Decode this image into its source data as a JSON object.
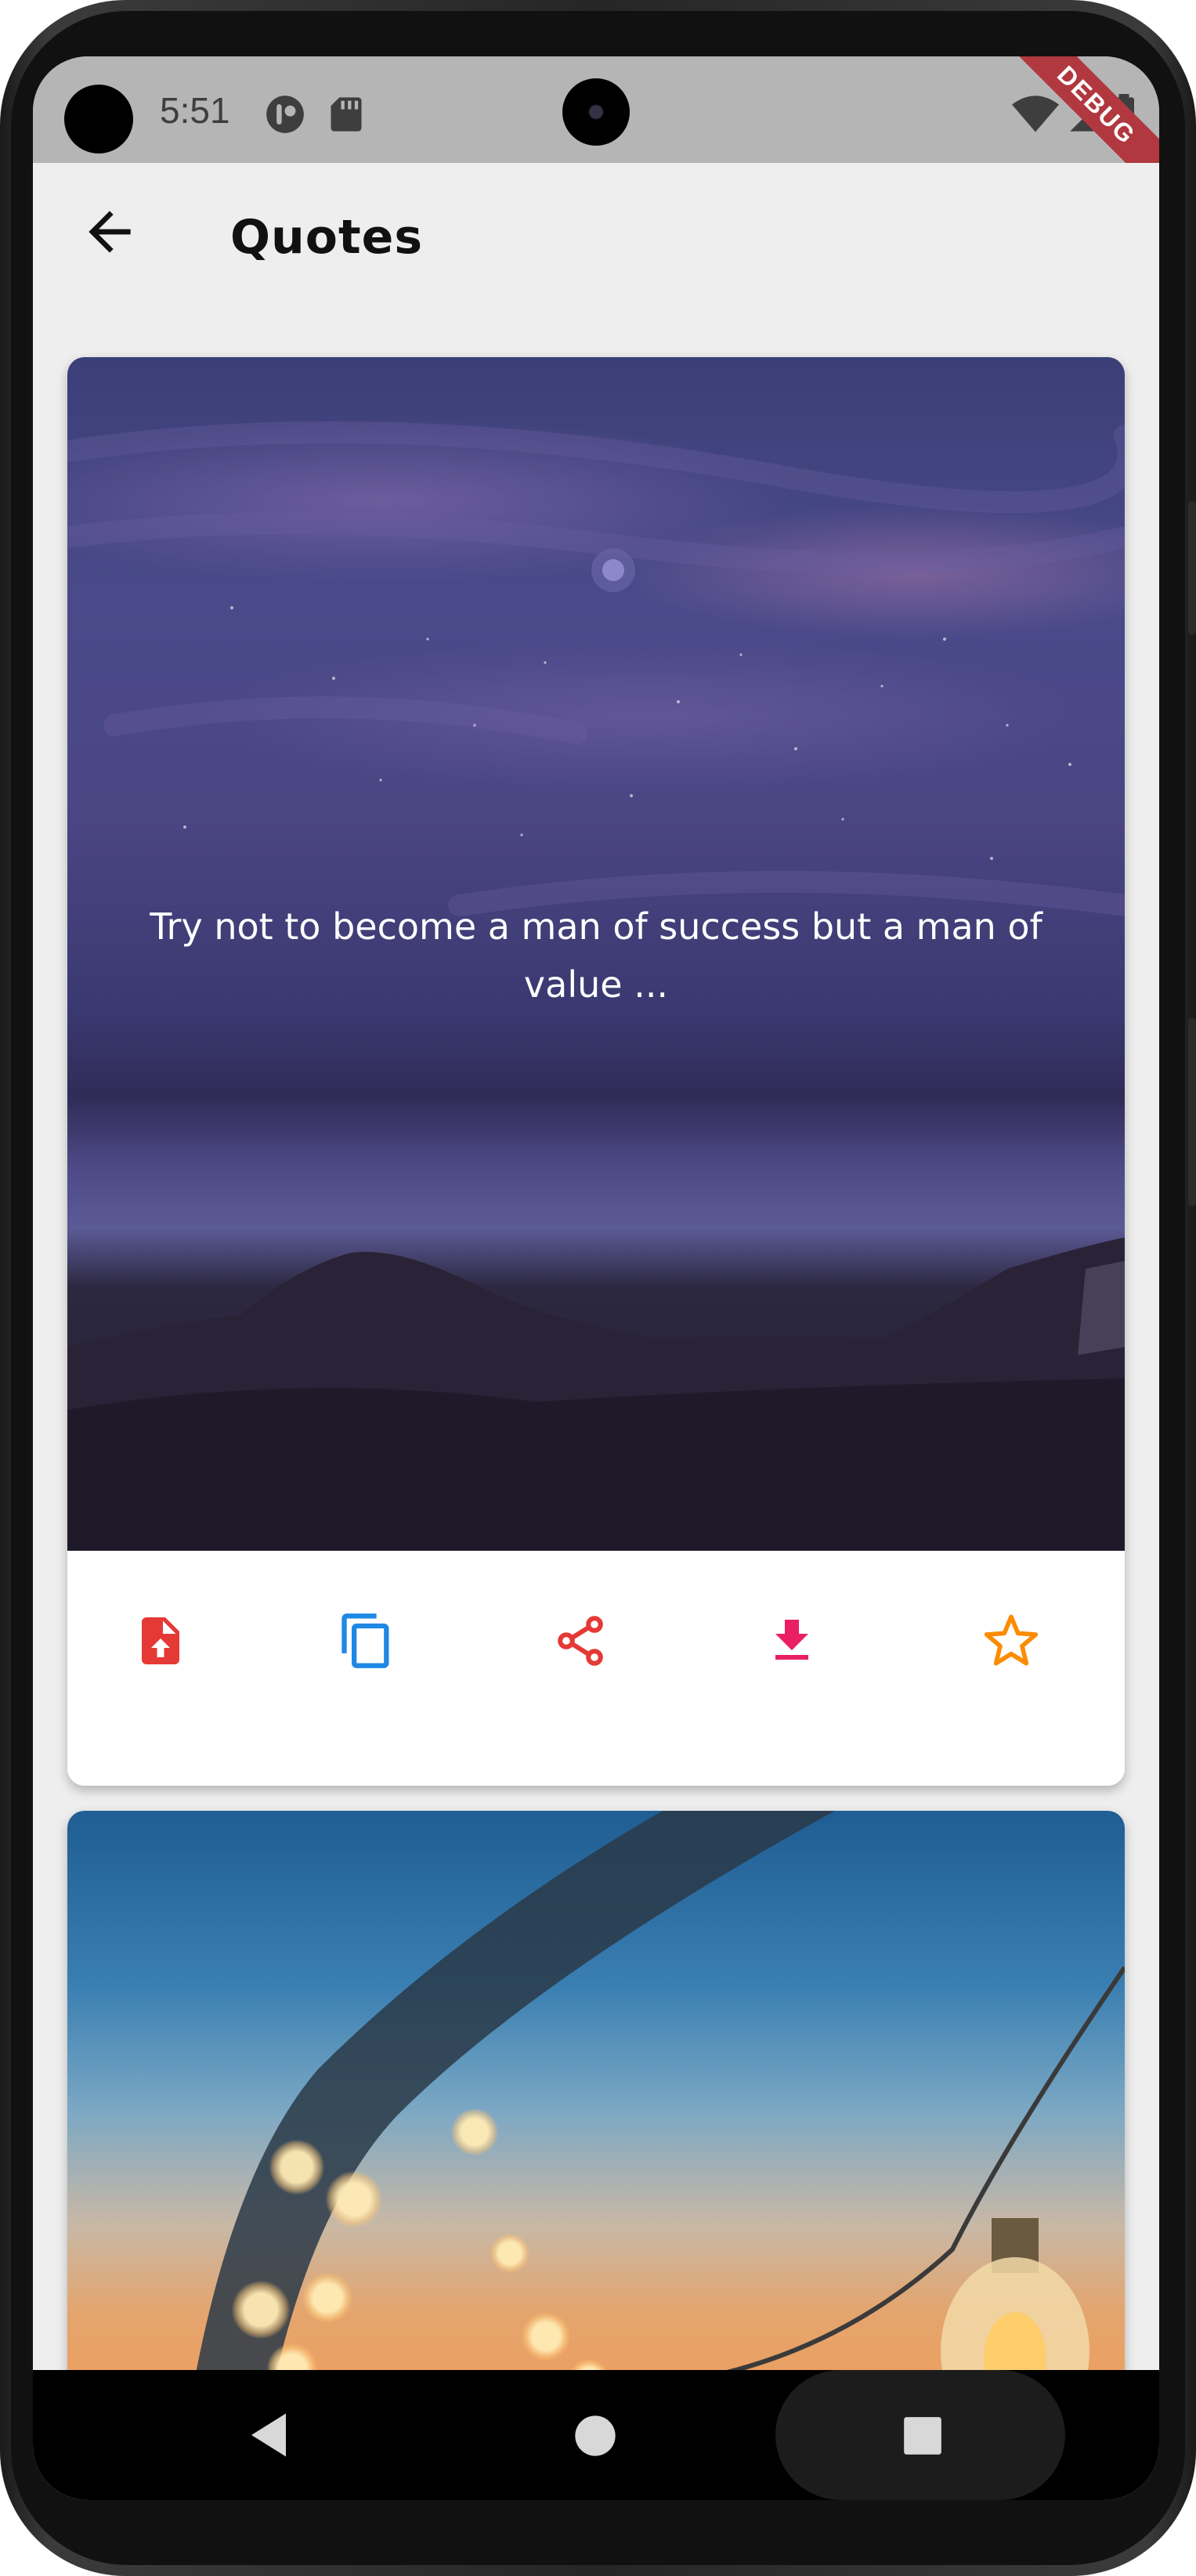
{
  "status_bar": {
    "time": "5:51",
    "icons": [
      "notification-icon",
      "sd-card-icon",
      "wifi-icon",
      "signal-icon",
      "battery-icon"
    ],
    "debug_label": "DEBUG"
  },
  "app_bar": {
    "title": "Quotes",
    "back_icon": "arrow-back-icon"
  },
  "cards": [
    {
      "quote": "Try not to become a man of success but a man of value ...",
      "actions": [
        {
          "icon": "file-upload-icon",
          "color": "#e53935"
        },
        {
          "icon": "copy-icon",
          "color": "#1e88e5"
        },
        {
          "icon": "share-icon",
          "color": "#e53935"
        },
        {
          "icon": "download-icon",
          "color": "#e91e63"
        },
        {
          "icon": "star-outline-icon",
          "color": "#fb8c00"
        }
      ]
    },
    {
      "quote": ""
    }
  ],
  "nav_bar": {
    "icons": [
      "nav-back-icon",
      "nav-home-icon",
      "nav-recents-icon"
    ]
  },
  "colors": {
    "background": "#eeeeee",
    "status_bar": "#b5b5b5",
    "debug_ribbon": "#b0383e"
  }
}
